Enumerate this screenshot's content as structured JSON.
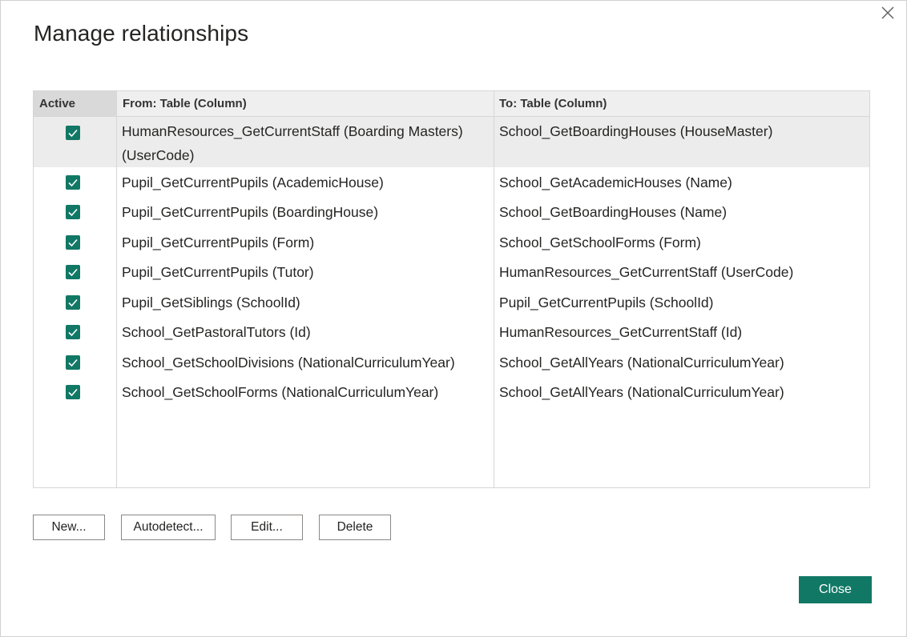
{
  "dialog": {
    "title": "Manage relationships",
    "close_icon": "close-icon"
  },
  "table": {
    "headers": {
      "active": "Active",
      "from": "From: Table (Column)",
      "to": "To: Table (Column)"
    },
    "rows": [
      {
        "active": true,
        "from": "HumanResources_GetCurrentStaff (Boarding Masters) (UserCode)",
        "to": "School_GetBoardingHouses (HouseMaster)",
        "selected": true
      },
      {
        "active": true,
        "from": "Pupil_GetCurrentPupils (AcademicHouse)",
        "to": "School_GetAcademicHouses (Name)"
      },
      {
        "active": true,
        "from": "Pupil_GetCurrentPupils (BoardingHouse)",
        "to": "School_GetBoardingHouses (Name)"
      },
      {
        "active": true,
        "from": "Pupil_GetCurrentPupils (Form)",
        "to": "School_GetSchoolForms (Form)"
      },
      {
        "active": true,
        "from": "Pupil_GetCurrentPupils (Tutor)",
        "to": "HumanResources_GetCurrentStaff (UserCode)"
      },
      {
        "active": true,
        "from": "Pupil_GetSiblings (SchoolId)",
        "to": "Pupil_GetCurrentPupils (SchoolId)"
      },
      {
        "active": true,
        "from": "School_GetPastoralTutors (Id)",
        "to": "HumanResources_GetCurrentStaff (Id)"
      },
      {
        "active": true,
        "from": "School_GetSchoolDivisions (NationalCurriculumYear)",
        "to": "School_GetAllYears (NationalCurriculumYear)"
      },
      {
        "active": true,
        "from": "School_GetSchoolForms (NationalCurriculumYear)",
        "to": "School_GetAllYears (NationalCurriculumYear)"
      }
    ]
  },
  "buttons": {
    "new": "New...",
    "autodetect": "Autodetect...",
    "edit": "Edit...",
    "delete": "Delete",
    "close": "Close"
  },
  "colors": {
    "accent": "#117865",
    "selected_row": "#ececec",
    "header_bg": "#efefef"
  }
}
